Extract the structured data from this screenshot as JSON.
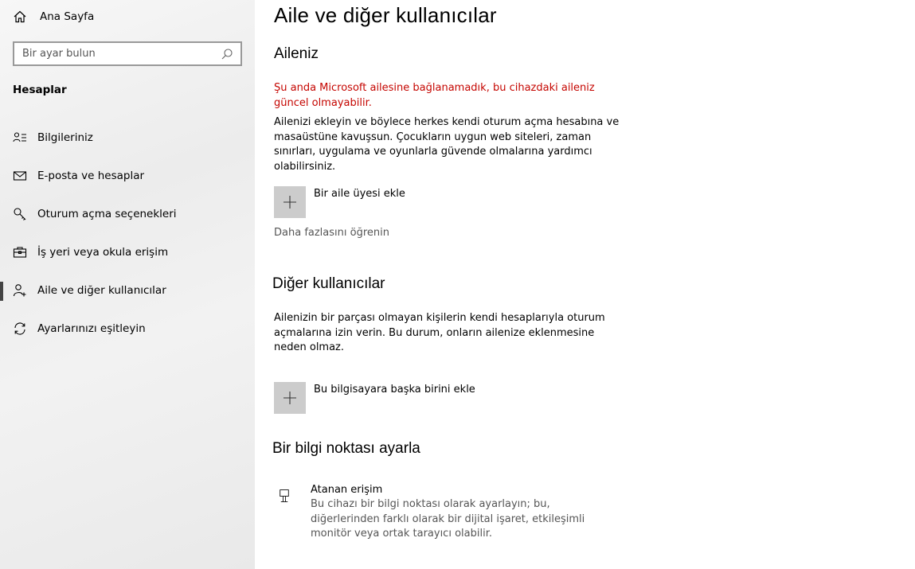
{
  "sidebar": {
    "home_label": "Ana Sayfa",
    "search_placeholder": "Bir ayar bulun",
    "section_title": "Hesaplar",
    "items": [
      {
        "label": "Bilgileriniz",
        "icon": "person-info-icon"
      },
      {
        "label": "E-posta ve hesaplar",
        "icon": "mail-icon"
      },
      {
        "label": "Oturum açma seçenekleri",
        "icon": "key-icon"
      },
      {
        "label": "İş yeri veya okula erişim",
        "icon": "briefcase-icon"
      },
      {
        "label": "Aile ve diğer kullanıcılar",
        "icon": "add-person-icon",
        "active": true
      },
      {
        "label": "Ayarlarınızı eşitleyin",
        "icon": "sync-icon"
      }
    ]
  },
  "main": {
    "title": "Aile ve diğer kullanıcılar",
    "family": {
      "heading": "Aileniz",
      "error": "Şu anda Microsoft ailesine bağlanamadık, bu cihazdaki aileniz güncel olmayabilir.",
      "description": "Ailenizi ekleyin ve böylece herkes kendi oturum açma hesabına ve masaüstüne kavuşsun. Çocukların uygun web siteleri, zaman sınırları, uygulama ve oyunlarla güvende olmalarına yardımcı olabilirsiniz.",
      "add_label": "Bir aile üyesi ekle",
      "learn_more": "Daha fazlasını öğrenin"
    },
    "other": {
      "heading": "Diğer kullanıcılar",
      "description": "Ailenizin bir parçası olmayan kişilerin kendi hesaplarıyla oturum açmalarına izin verin. Bu durum, onların ailenize eklenmesine neden olmaz.",
      "add_label": "Bu bilgisayara başka birini ekle"
    },
    "kiosk": {
      "heading": "Bir bilgi noktası ayarla",
      "title": "Atanan erişim",
      "description": "Bu cihazı bir bilgi noktası olarak ayarlayın; bu, diğerlerinden farklı olarak bir dijital işaret, etkileşimli monitör veya ortak tarayıcı olabilir."
    }
  },
  "colors": {
    "error": "#c50500",
    "plus_box": "#cccccc",
    "active_indicator": "#444444"
  }
}
